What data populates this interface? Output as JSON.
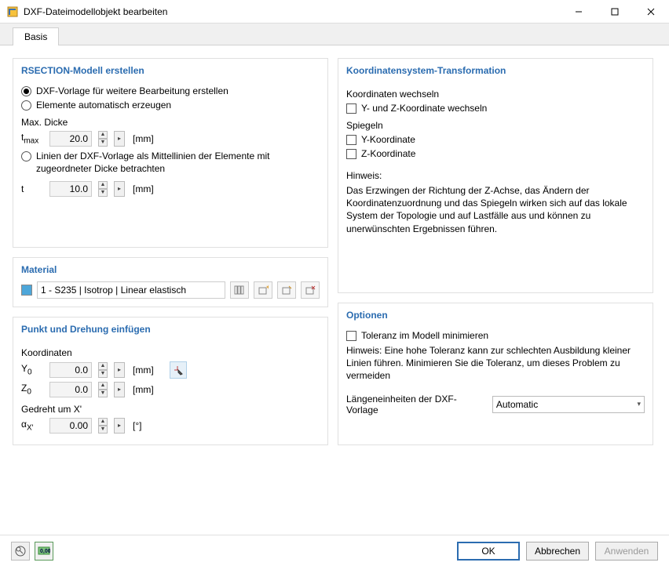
{
  "titlebar": {
    "title": "DXF-Dateimodellobjekt bearbeiten"
  },
  "tabs": {
    "basis": "Basis"
  },
  "rsection": {
    "head": "RSECTION-Modell erstellen",
    "opt1": "DXF-Vorlage für weitere Bearbeitung erstellen",
    "opt2": "Elemente automatisch erzeugen",
    "maxDickeLabel": "Max. Dicke",
    "tmaxLabel": "tmax",
    "tmaxValue": "20.0",
    "tmaxUnit": "[mm]",
    "opt3": "Linien der DXF-Vorlage als Mittellinien der Elemente mit zugeordneter Dicke betrachten",
    "tLabel": "t",
    "tValue": "10.0",
    "tUnit": "[mm]"
  },
  "material": {
    "head": "Material",
    "value": "1 - S235 | Isotrop | Linear elastisch"
  },
  "point": {
    "head": "Punkt und Drehung einfügen",
    "koordLabel": "Koordinaten",
    "y0Label": "Y0",
    "y0Value": "0.0",
    "y0Unit": "[mm]",
    "z0Label": "Z0",
    "z0Value": "0.0",
    "z0Unit": "[mm]",
    "rotLabel": "Gedreht um X'",
    "alphaLabel": "αX'",
    "alphaValue": "0.00",
    "alphaUnit": "[°]"
  },
  "coord": {
    "head": "Koordinatensystem-Transformation",
    "swapLabel": "Koordinaten wechseln",
    "swapYZ": "Y- und Z-Koordinate wechseln",
    "mirrorLabel": "Spiegeln",
    "mirrorY": "Y-Koordinate",
    "mirrorZ": "Z-Koordinate",
    "hintLabel": "Hinweis:",
    "hintBody": "Das Erzwingen der Richtung der Z-Achse, das Ändern der Koordinatenzuordnung und das Spiegeln wirken sich auf das lokale System der Topologie und auf Lastfälle aus und können zu unerwünschten Ergebnissen führen."
  },
  "options": {
    "head": "Optionen",
    "tolCheck": "Toleranz im Modell minimieren",
    "tolHint": "Hinweis: Eine hohe Toleranz kann zur schlechten Ausbildung kleiner Linien führen. Minimieren Sie die Toleranz, um dieses Problem zu vermeiden",
    "lenLabel": "Längeneinheiten der DXF-Vorlage",
    "lenValue": "Automatic"
  },
  "footer": {
    "ok": "OK",
    "cancel": "Abbrechen",
    "apply": "Anwenden"
  }
}
